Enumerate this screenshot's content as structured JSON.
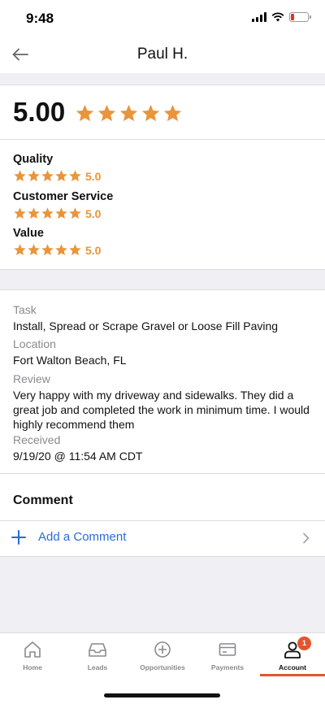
{
  "status_bar": {
    "time": "9:48"
  },
  "header": {
    "title": "Paul H."
  },
  "rating": {
    "overall_score": "5.00",
    "overall_stars": 5,
    "star_color": "#e8953b",
    "categories": [
      {
        "name": "Quality",
        "value": "5.0",
        "stars": 5
      },
      {
        "name": "Customer Service",
        "value": "5.0",
        "stars": 5
      },
      {
        "name": "Value",
        "value": "5.0",
        "stars": 5
      }
    ]
  },
  "details": {
    "task_label": "Task",
    "task_value": "Install, Spread or Scrape Gravel or Loose Fill Paving",
    "location_label": "Location",
    "location_value": "Fort Walton Beach, FL",
    "review_label": "Review",
    "review_value": "Very happy with my driveway and sidewalks. They did a great job and completed the work in minimum time. I would highly recommend them",
    "received_label": "Received",
    "received_value": "9/19/20 @ 11:54 AM CDT"
  },
  "comment": {
    "heading": "Comment",
    "add_label": "Add a Comment"
  },
  "tabs": [
    {
      "label": "Home",
      "icon": "home-icon"
    },
    {
      "label": "Leads",
      "icon": "inbox-icon"
    },
    {
      "label": "Opportunities",
      "icon": "plus-circle-icon"
    },
    {
      "label": "Payments",
      "icon": "credit-card-icon"
    },
    {
      "label": "Account",
      "icon": "user-icon",
      "active": true,
      "badge": "1"
    }
  ],
  "colors": {
    "accent_orange": "#e4552d",
    "link_blue": "#2b6bd6",
    "star": "#e8953b"
  }
}
